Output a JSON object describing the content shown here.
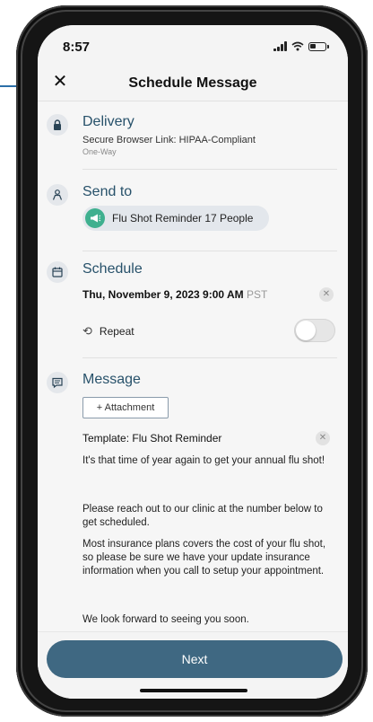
{
  "status_bar": {
    "time": "8:57"
  },
  "header": {
    "title": "Schedule Message",
    "close_glyph": "✕"
  },
  "delivery": {
    "title": "Delivery",
    "method": "Secure Browser Link: HIPAA-Compliant",
    "direction": "One-Way"
  },
  "send_to": {
    "title": "Send to",
    "recipient_chip": "Flu Shot Reminder 17 People"
  },
  "schedule": {
    "title": "Schedule",
    "datetime": "Thu, November 9, 2023 9:00 AM",
    "timezone": "PST",
    "repeat_label": "Repeat",
    "repeat_enabled": false
  },
  "message": {
    "title": "Message",
    "attachment_button": "+ Attachment",
    "template_label": "Template: Flu Shot Reminder",
    "paragraphs": [
      "It's that time of year again to get your annual flu shot!",
      "Please reach out to our clinic at the number below to get scheduled.",
      "Most insurance plans covers the cost of your flu shot, so please be sure we have your update insurance information when you call to setup your appointment.",
      "We look forward to seeing you soon."
    ]
  },
  "footer": {
    "next_label": "Next"
  },
  "colors": {
    "accent": "#3f6882",
    "section_title": "#27516a",
    "chip_icon": "#3fb08f"
  },
  "icons": {
    "delivery": "lock-icon",
    "send_to": "person-icon",
    "schedule": "calendar-icon",
    "message": "message-icon",
    "chip": "megaphone-icon",
    "repeat": "repeat-icon"
  }
}
